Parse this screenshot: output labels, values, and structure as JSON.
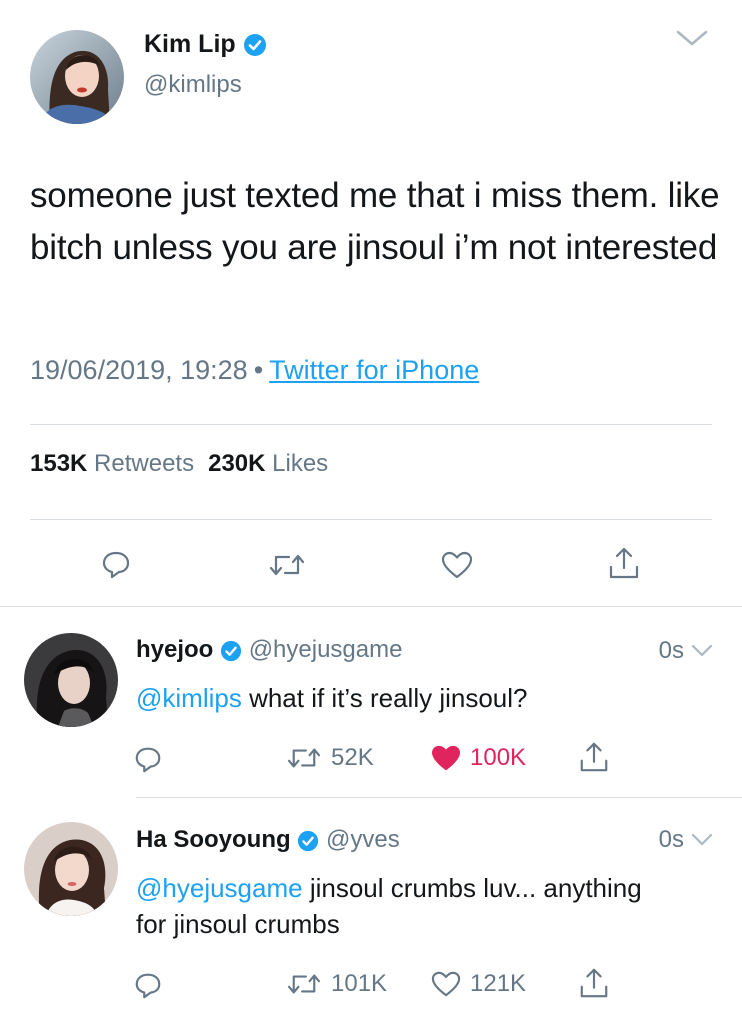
{
  "tweet": {
    "author_name": "Kim Lip",
    "author_handle": "@kimlips",
    "text": "someone just texted me that i miss them. like bitch unless you are jinsoul i’m not interested",
    "timestamp": "19/06/2019, 19:28",
    "separator": "•",
    "source": "Twitter for iPhone",
    "retweets_count": "153K",
    "retweets_label": "Retweets",
    "likes_count": "230K",
    "likes_label": "Likes"
  },
  "replies": [
    {
      "name": "hyejoo",
      "handle": "@hyejusgame",
      "time": "0s",
      "mention": "@kimlips",
      "text": " what if it’s really jinsoul?",
      "retweets": "52K",
      "likes": "100K",
      "liked": true
    },
    {
      "name": "Ha Sooyoung",
      "handle": "@yves",
      "time": "0s",
      "mention": "@hyejusgame",
      "text": " jinsoul crumbs luv... anything for jinsoul crumbs",
      "retweets": "101K",
      "likes": "121K",
      "liked": false
    }
  ],
  "icons": {
    "verified": "verified-badge-icon",
    "reply": "reply-icon",
    "retweet": "retweet-icon",
    "like": "heart-icon",
    "share": "share-icon",
    "menu": "chevron-down-icon"
  },
  "colors": {
    "accent": "#1da1f2",
    "like": "#e0245e",
    "muted": "#657786",
    "text": "#14171a",
    "divider": "#d8dde2"
  }
}
